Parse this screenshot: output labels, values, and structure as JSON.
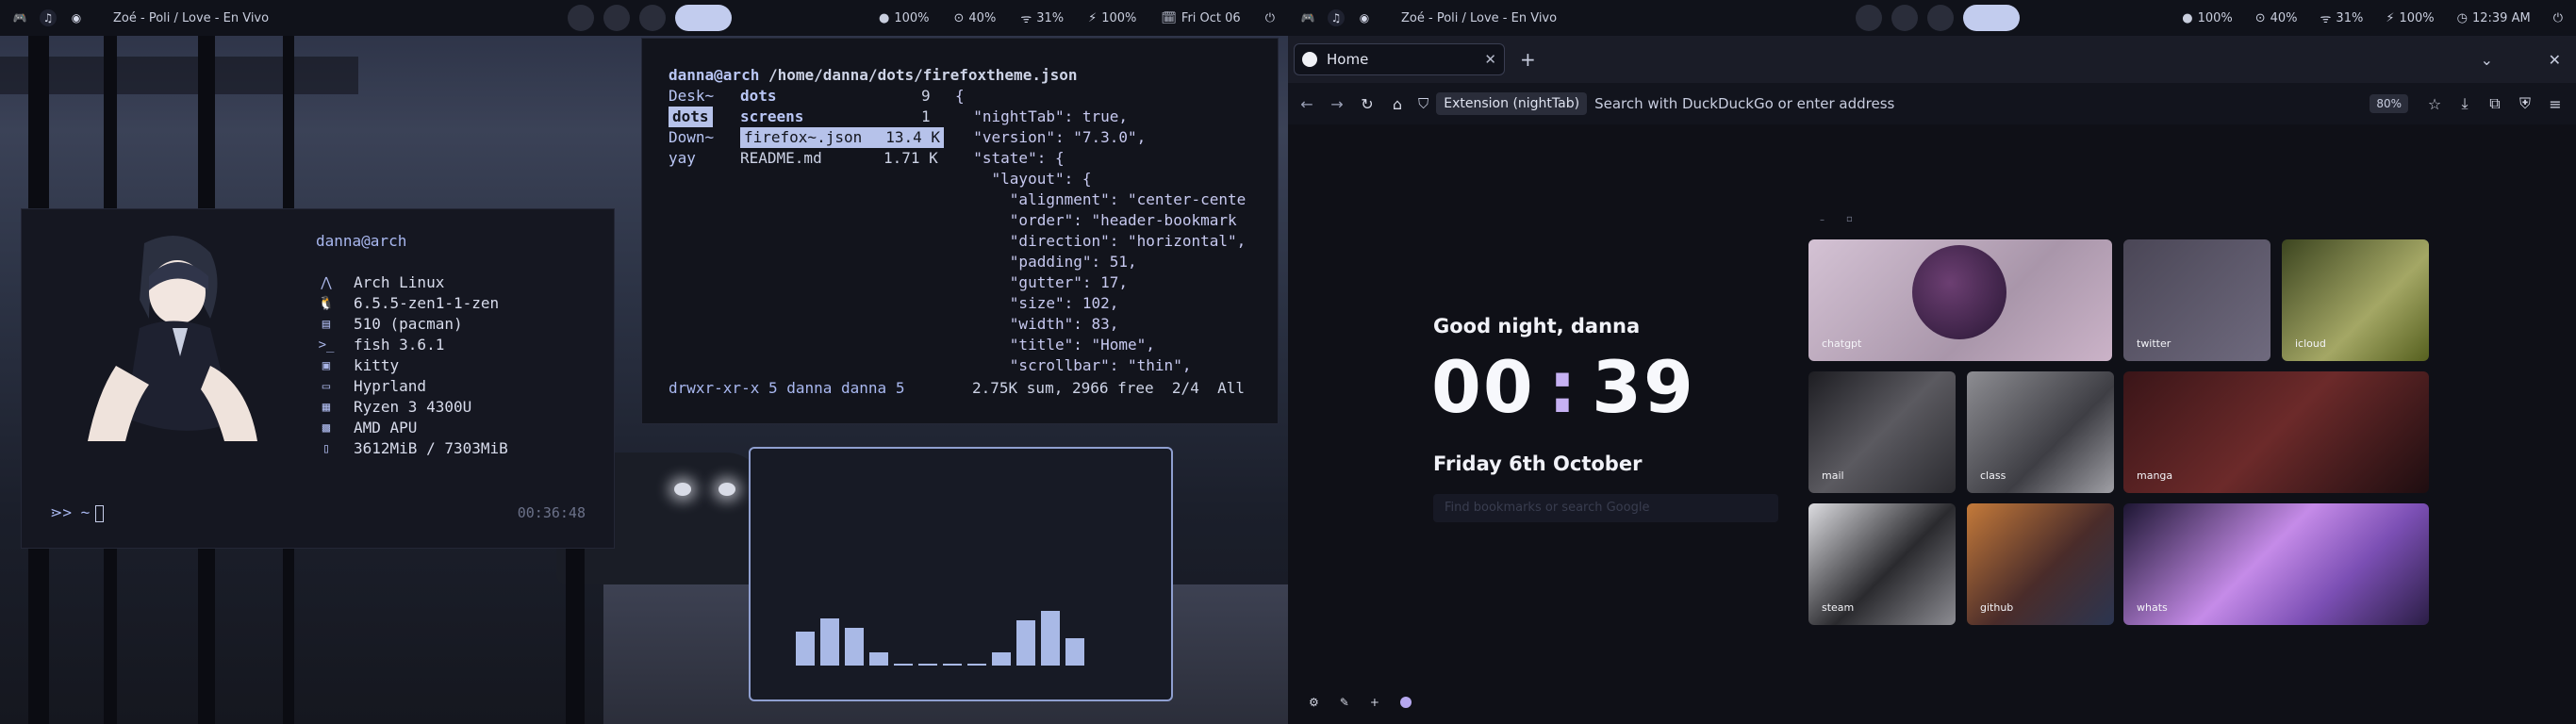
{
  "left_bar": {
    "title": "Zoé - Poli / Love - En Vivo",
    "icons": [
      "gamepad-icon",
      "spotify-icon",
      "circle-icon"
    ],
    "stats": [
      "100%",
      "40%",
      "31%",
      "100%",
      "Fri Oct 06"
    ],
    "stat_icons": [
      "●",
      "⊙",
      "ᯤ",
      "⚡",
      "🗓"
    ],
    "power_icon": "⏻"
  },
  "right_bar": {
    "title": "Zoé - Poli / Love - En Vivo",
    "stats": [
      "100%",
      "40%",
      "31%",
      "100%",
      "12:39 AM"
    ],
    "stat_icons": [
      "●",
      "⊙",
      "ᯤ",
      "⚡",
      "◷"
    ],
    "power_icon": "⏻"
  },
  "fetch": {
    "user": "danna@arch",
    "items": [
      {
        "icon": "⋀",
        "value": "Arch Linux"
      },
      {
        "icon": "🐧",
        "value": "6.5.5-zen1-1-zen"
      },
      {
        "icon": "▤",
        "value": "510 (pacman)"
      },
      {
        "icon": ">_",
        "value": "fish 3.6.1"
      },
      {
        "icon": "▣",
        "value": "kitty"
      },
      {
        "icon": "▭",
        "value": "Hyprland"
      },
      {
        "icon": "▦",
        "value": "Ryzen 3 4300U"
      },
      {
        "icon": "▩",
        "value": "AMD APU"
      },
      {
        "icon": "▯",
        "value": "3612MiB / 7303MiB"
      }
    ],
    "prompt": "⋗> ~",
    "time": "00:36:48"
  },
  "file_manager": {
    "path_user": "danna@arch",
    "path": "/home/danna/dots/firefoxtheme.json",
    "col1": [
      "Desk~",
      "dots",
      "Down~",
      "yay"
    ],
    "col2": [
      {
        "name": "dots",
        "size": "9"
      },
      {
        "name": "screens",
        "size": "1"
      },
      {
        "name": "firefox~.json",
        "size": "13.4 K"
      },
      {
        "name": "README.md",
        "size": "1.71 K"
      }
    ],
    "preview": [
      "{",
      "  \"nightTab\": true,",
      "  \"version\": \"7.3.0\",",
      "  \"state\": {",
      "    \"layout\": {",
      "      \"alignment\": \"center-cente",
      "      \"order\": \"header-bookmark",
      "      \"direction\": \"horizontal\",",
      "      \"padding\": 51,",
      "      \"gutter\": 17,",
      "      \"size\": 102,",
      "      \"width\": 83,",
      "      \"title\": \"Home\",",
      "      \"scrollbar\": \"thin\","
    ],
    "status_left": "drwxr-xr-x 5 danna danna 5",
    "status_right": "2.75K sum, 2966 free  2/4  All"
  },
  "visualizer_levels": [
    0.3,
    0.42,
    0.33,
    0.12,
    0.02,
    0.02,
    0.02,
    0.02,
    0.12,
    0.4,
    0.48,
    0.24
  ],
  "browser": {
    "tab_title": "Home",
    "new_tab": "+",
    "extension_label": "Extension (nightTab)",
    "address_placeholder": "Search with DuckDuckGo or enter address",
    "zoom": "80%",
    "greeting": "Good night, danna",
    "clock_h": "00",
    "clock_sep": ":",
    "clock_m": "39",
    "date": "Friday 6th October",
    "search_placeholder": "Find bookmarks or search Google",
    "bookmarks": [
      "chatgpt",
      "twitter",
      "icloud",
      "mail",
      "class",
      "manga",
      "steam",
      "github",
      "whats"
    ]
  }
}
